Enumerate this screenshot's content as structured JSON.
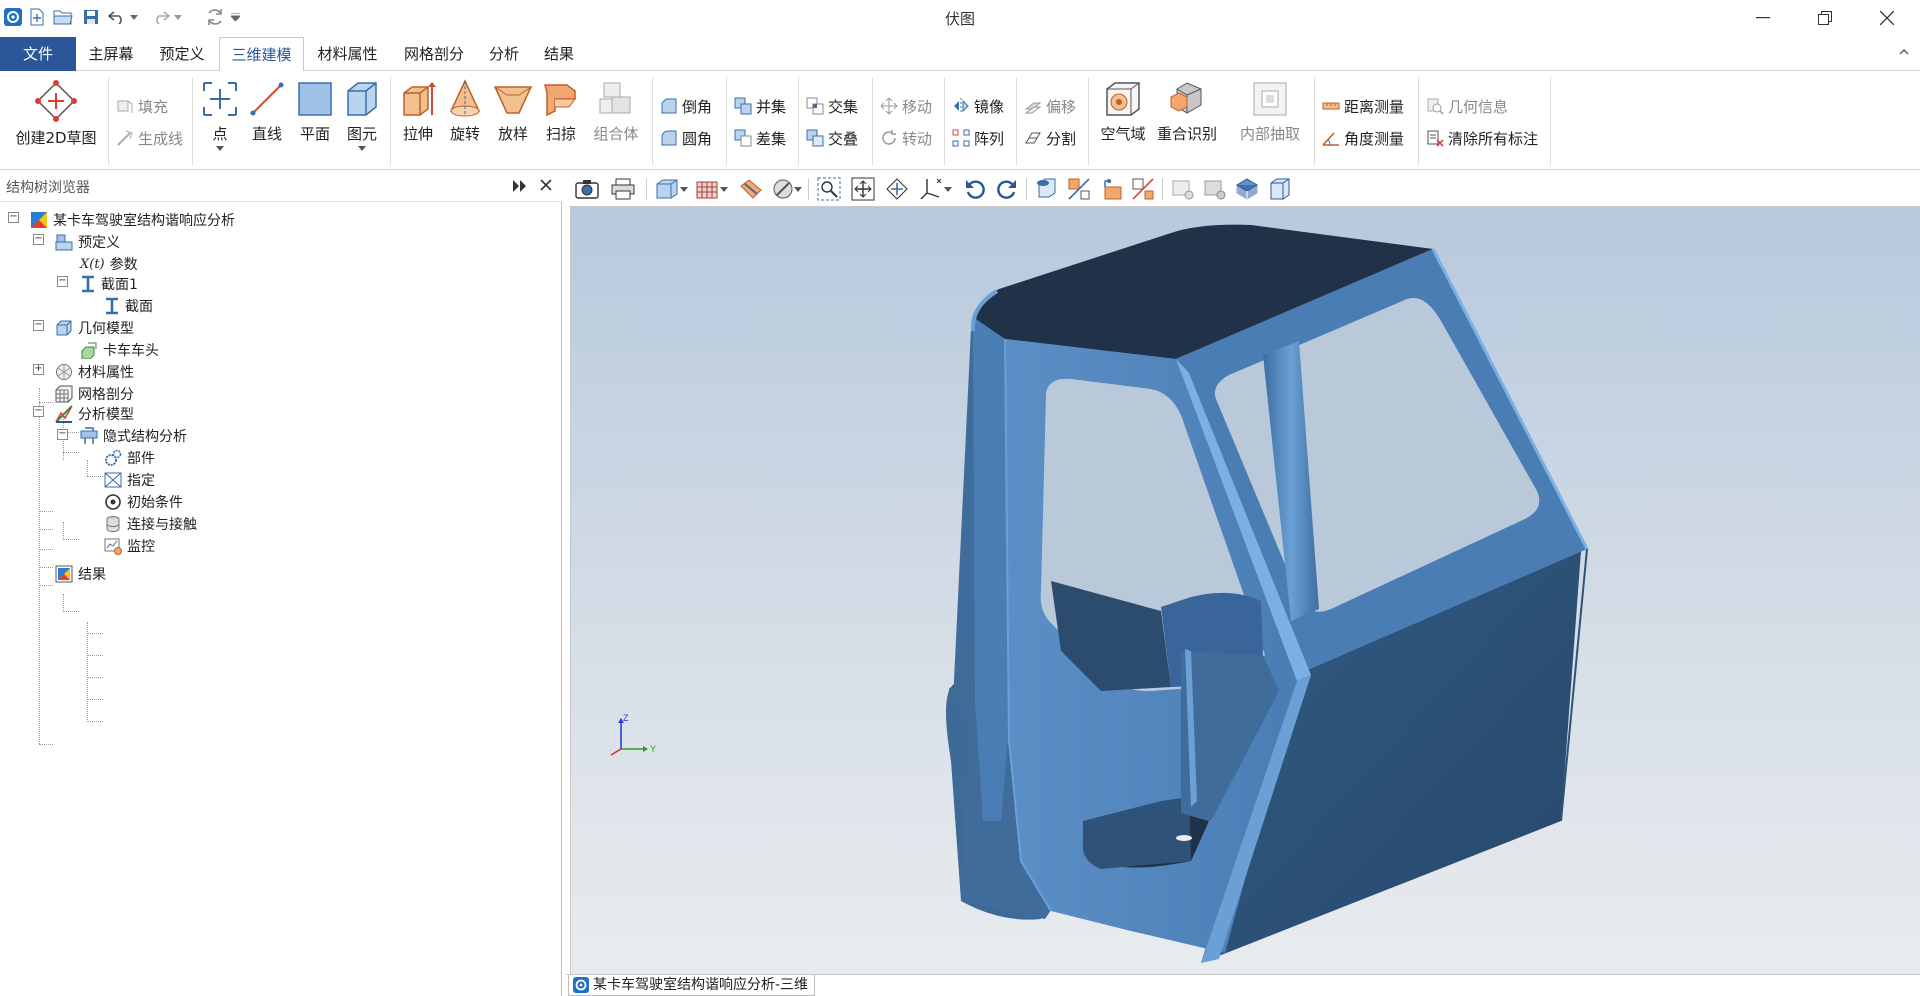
{
  "window": {
    "title": "伏图",
    "minimize_icon": "minimize-icon",
    "maximize_icon": "restore-icon",
    "close_icon": "close-icon"
  },
  "menu": {
    "file": "文件",
    "tabs": [
      "主屏幕",
      "预定义",
      "三维建模",
      "材料属性",
      "网格剖分",
      "分析",
      "结果"
    ],
    "active": "三维建模"
  },
  "ribbon": {
    "create_sketch": "创建2D草图",
    "fill": "填充",
    "gen_line": "生成线",
    "point": "点",
    "line": "直线",
    "plane": "平面",
    "primitive": "图元",
    "extrude": "拉伸",
    "revolve": "旋转",
    "loft": "放样",
    "sweep": "扫掠",
    "assembly": "组合体",
    "chamfer": "倒角",
    "fillet": "圆角",
    "union": "并集",
    "subtract": "差集",
    "intersect": "交集",
    "overlap": "交叠",
    "move": "移动",
    "rotate": "转动",
    "mirror": "镜像",
    "array": "阵列",
    "offset": "偏移",
    "split": "分割",
    "air_domain": "空气域",
    "overlap_detect": "重合识别",
    "inner_extract": "内部抽取",
    "distance": "距离测量",
    "angle": "角度测量",
    "geom_info": "几何信息",
    "clear_marks": "清除所有标注"
  },
  "tree": {
    "panel_title": "结构树浏览器",
    "root": "某卡车驾驶室结构谐响应分析",
    "predef": "预定义",
    "params": "参数",
    "section1": "截面1",
    "section": "截面",
    "geom_model": "几何模型",
    "truck_head": "卡车车头",
    "material": "材料属性",
    "mesh": "网格剖分",
    "analysis_model": "分析模型",
    "implicit": "隐式结构分析",
    "part": "部件",
    "assign": "指定",
    "initial": "初始条件",
    "contact": "连接与接触",
    "monitor": "监控",
    "result": "结果"
  },
  "viewport": {
    "axis_z": "Z",
    "axis_y": "Y",
    "doc_tab": "某卡车驾驶室结构谐响应分析-三维"
  },
  "colors": {
    "accent": "#2b579a",
    "model_top": "#1f3247",
    "model_face": "#4477aa",
    "model_light": "#5e93c8",
    "model_dark": "#2c4c6e"
  }
}
